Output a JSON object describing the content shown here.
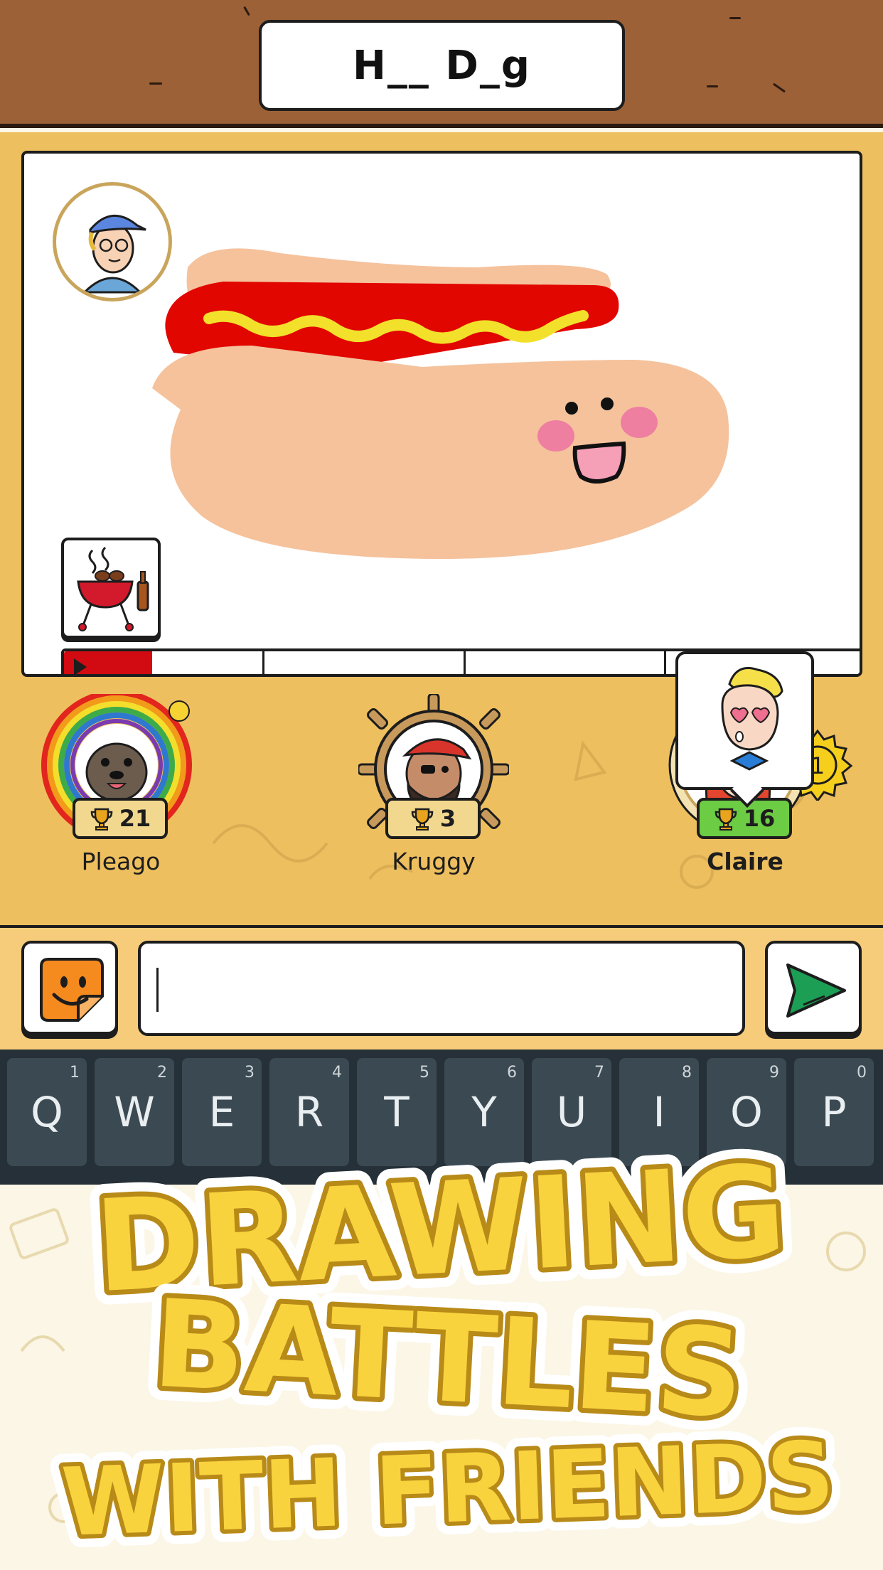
{
  "word_hint": "H__ D_g",
  "players": [
    {
      "name": "Pleago",
      "score": "21"
    },
    {
      "name": "Kruggy",
      "score": "3"
    },
    {
      "name": "Claire",
      "score": "16",
      "rank": "1"
    }
  ],
  "drawing_progress": 0.11,
  "chat": {
    "placeholder": ""
  },
  "keyboard": {
    "keys": [
      {
        "label": "Q",
        "num": "1"
      },
      {
        "label": "W",
        "num": "2"
      },
      {
        "label": "E",
        "num": "3"
      },
      {
        "label": "R",
        "num": "4"
      },
      {
        "label": "T",
        "num": "5"
      },
      {
        "label": "Y",
        "num": "6"
      },
      {
        "label": "U",
        "num": "7"
      },
      {
        "label": "I",
        "num": "8"
      },
      {
        "label": "O",
        "num": "9"
      },
      {
        "label": "P",
        "num": "0"
      }
    ]
  },
  "promo": {
    "line1": "DRAWING",
    "line2": "BATTLES",
    "line3": "WITH FRIENDS"
  },
  "colors": {
    "wood": "#9c6136",
    "panel": "#eebf5f",
    "accent_red": "#d20a11",
    "leader_green": "#6ccc43",
    "title_yellow": "#f9d33e",
    "title_outline": "#b88a17"
  },
  "icons": [
    "trophy-icon",
    "send-icon",
    "sticker-icon",
    "grill-icon",
    "rank-badge-icon"
  ]
}
